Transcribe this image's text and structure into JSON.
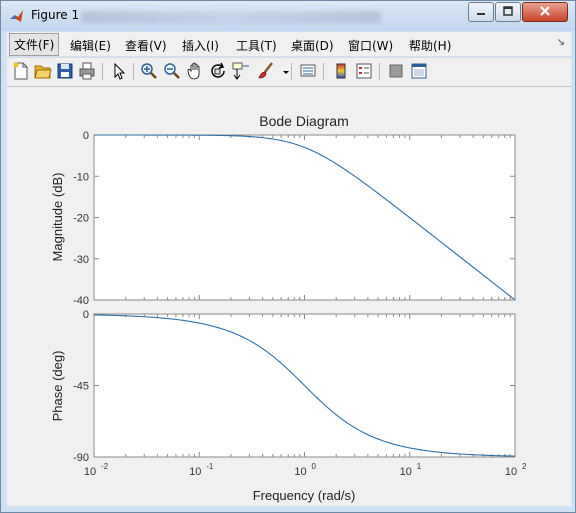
{
  "window": {
    "title": "Figure 1"
  },
  "menubar": {
    "items": [
      {
        "label": "文件(F)",
        "active": true
      },
      {
        "label": "编辑(E)"
      },
      {
        "label": "查看(V)"
      },
      {
        "label": "插入(I)"
      },
      {
        "label": "工具(T)"
      },
      {
        "label": "桌面(D)"
      },
      {
        "label": "窗口(W)"
      },
      {
        "label": "帮助(H)"
      }
    ]
  },
  "toolbar": {
    "icons": [
      "new-figure-icon",
      "open-file-icon",
      "save-icon",
      "print-icon",
      "select-arrow-icon",
      "zoom-in-icon",
      "zoom-out-icon",
      "pan-hand-icon",
      "rotate-3d-icon",
      "data-cursor-icon",
      "brush-icon",
      "link-plot-icon",
      "colorbar-icon",
      "legend-icon",
      "hide-plot-tools-icon",
      "show-plot-tools-icon"
    ]
  },
  "chart_data": {
    "type": "line",
    "title": "Bode Diagram",
    "xlabel": "Frequency  (rad/s)",
    "xscale": "log",
    "xlim": [
      0.01,
      100
    ],
    "xticks": [
      "10",
      "10",
      "10",
      "10",
      "10"
    ],
    "xtick_exponents": [
      "-2",
      "-1",
      "0",
      "1",
      "2"
    ],
    "color": "#2f6fa6",
    "panels": [
      {
        "ylabel": "Magnitude (dB)",
        "ylim": [
          -40,
          0
        ],
        "yticks": [
          "0",
          "-10",
          "-20",
          "-30",
          "-40"
        ],
        "x": [
          0.01,
          0.1,
          0.3,
          0.5,
          1,
          2,
          3,
          5,
          10,
          20,
          50,
          100
        ],
        "y": [
          0,
          -0.04,
          -0.37,
          -0.97,
          -3.01,
          -6.99,
          -10,
          -14.15,
          -20.04,
          -26.03,
          -33.98,
          -40
        ]
      },
      {
        "ylabel": "Phase (deg)",
        "ylim": [
          -90,
          0
        ],
        "yticks": [
          "0",
          "-45",
          "-90"
        ],
        "x": [
          0.01,
          0.1,
          0.3,
          0.5,
          1,
          2,
          3,
          5,
          10,
          20,
          50,
          100
        ],
        "y": [
          -0.6,
          -5.7,
          -16.7,
          -26.6,
          -45,
          -63.4,
          -71.6,
          -78.7,
          -84.3,
          -87.1,
          -88.9,
          -89.4
        ]
      }
    ]
  }
}
